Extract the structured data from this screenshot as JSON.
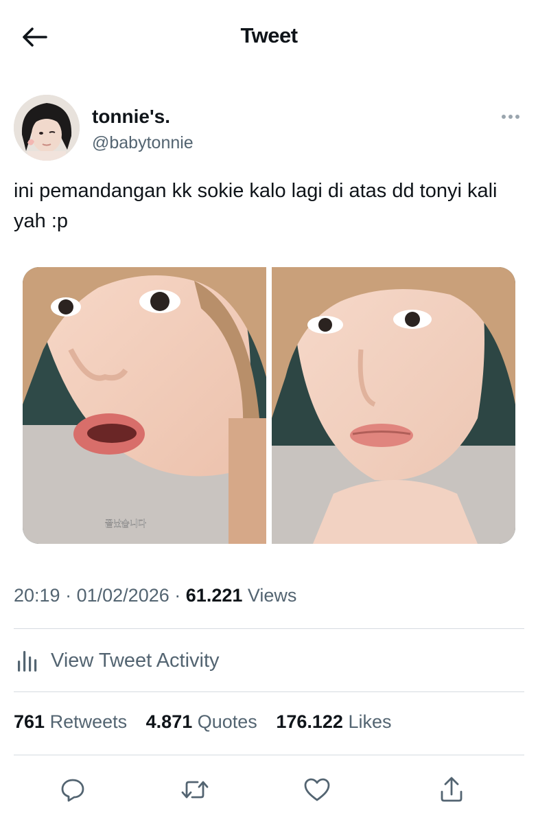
{
  "header": {
    "title": "Tweet",
    "back_icon": "arrow-left-icon"
  },
  "author": {
    "display_name": "tonnie's.",
    "handle": "@babytonnie",
    "more_icon": "more-dots-icon"
  },
  "tweet": {
    "text": "ini pemandangan kk sokie kalo lagi di atas dd tonyi kali yah :p",
    "media_caption_korean": "끝났습니다"
  },
  "meta": {
    "time": "20:19",
    "date": "01/02/2026",
    "views_count": "61.221",
    "views_label": "Views",
    "sep": "·"
  },
  "activity": {
    "label": "View Tweet Activity",
    "icon": "bar-chart-icon"
  },
  "stats": {
    "retweets_count": "761",
    "retweets_label": "Retweets",
    "quotes_count": "4.871",
    "quotes_label": "Quotes",
    "likes_count": "176.122",
    "likes_label": "Likes"
  },
  "actions": [
    "reply-icon",
    "retweet-icon",
    "like-icon",
    "share-icon"
  ],
  "colors": {
    "text": "#0f1419",
    "secondary": "#536471",
    "divider": "#d5dbe0",
    "icon": "#536471"
  }
}
